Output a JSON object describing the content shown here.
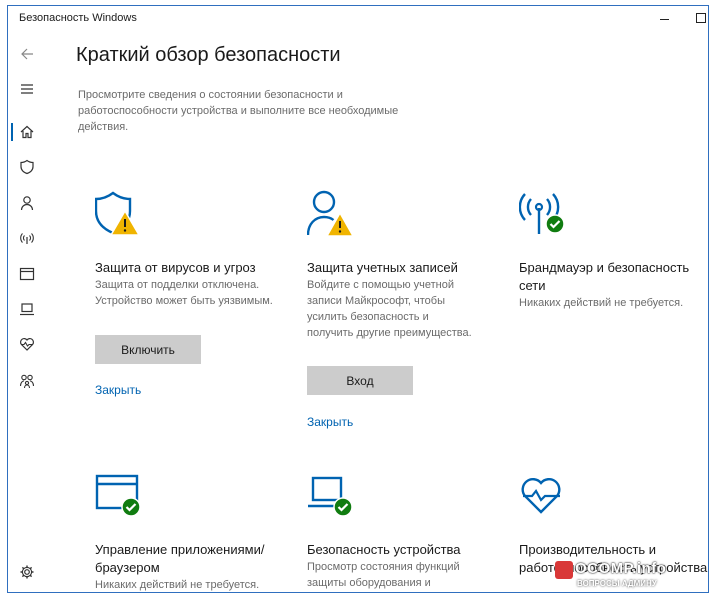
{
  "window": {
    "title": "Безопасность Windows"
  },
  "sidebar": {
    "items": [
      {
        "icon": "back-arrow-icon"
      },
      {
        "icon": "hamburger-menu-icon"
      },
      {
        "icon": "home-icon",
        "active": true
      },
      {
        "icon": "shield-icon"
      },
      {
        "icon": "person-icon"
      },
      {
        "icon": "wireless-antenna-icon"
      },
      {
        "icon": "app-window-icon"
      },
      {
        "icon": "laptop-icon"
      },
      {
        "icon": "heart-pulse-icon"
      },
      {
        "icon": "family-icon"
      },
      {
        "icon": "settings-gear-icon"
      }
    ]
  },
  "main": {
    "title": "Краткий обзор безопасности",
    "description": "Просмотрите сведения о состоянии безопасности и работоспособности устройства и выполните все необходимые действия."
  },
  "cards": [
    {
      "title": "Защита от вирусов и угроз",
      "description": "Защита от подделки отключена. Устройство может быть уязвимым.",
      "button": "Включить",
      "link": "Закрыть",
      "status": "warning"
    },
    {
      "title": "Защита учетных записей",
      "description": "Войдите с помощью учетной записи Майкрософт, чтобы усилить безопасность и получить другие преимущества.",
      "button": "Вход",
      "link": "Закрыть",
      "status": "warning"
    },
    {
      "title": "Брандмауэр и безопасность сети",
      "description": "Никаких действий не требуется.",
      "status": "ok"
    },
    {
      "title": "Управление приложениями/браузером",
      "description": "Никаких действий не требуется.",
      "status": "ok"
    },
    {
      "title": "Безопасность устройства",
      "description": "Просмотр состояния функций защиты оборудования и управление ими",
      "status": "ok"
    },
    {
      "title": "Производительность и работоспособность устройства",
      "description": "",
      "status": "ok"
    }
  ],
  "colors": {
    "accent": "#0063b1",
    "warning": "#f0b400",
    "ok": "#107c10"
  },
  "watermark": {
    "main": "OCOMP.info",
    "sub": "ВОПРОСЫ АДМИНУ"
  }
}
